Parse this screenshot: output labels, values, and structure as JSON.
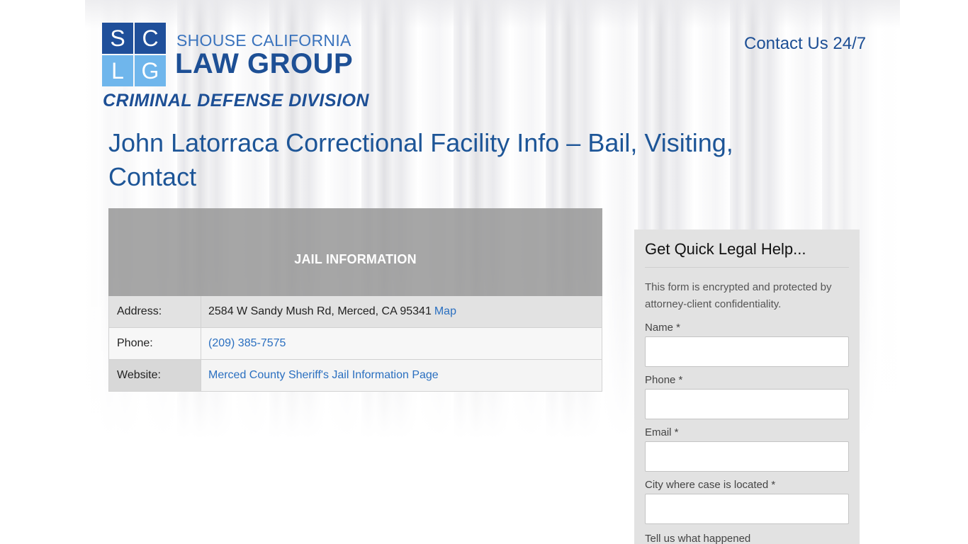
{
  "logo": {
    "letters": [
      "S",
      "C",
      "L",
      "G"
    ],
    "top_text": "SHOUSE CALIFORNIA",
    "main_text": "LAW GROUP",
    "division": "CRIMINAL DEFENSE DIVISION"
  },
  "header": {
    "contact_label": "Contact Us 24/7"
  },
  "page": {
    "title": "John Latorraca Correctional Facility Info – Bail, Visiting, Contact"
  },
  "jail_info": {
    "heading": "JAIL INFORMATION",
    "rows": [
      {
        "label": "Address:",
        "value": "2584 W Sandy Mush Rd, Merced, CA 95341",
        "link": "Map"
      },
      {
        "label": "Phone:",
        "link": "(209) 385-7575"
      },
      {
        "label": "Website:",
        "link": "Merced County Sheriff's Jail Information Page"
      }
    ]
  },
  "form": {
    "title": "Get Quick Legal Help...",
    "note": "This form is encrypted and protected by attorney-client confidentiality.",
    "fields": [
      {
        "label": "Name *",
        "value": ""
      },
      {
        "label": "Phone *",
        "value": ""
      },
      {
        "label": "Email *",
        "value": ""
      },
      {
        "label": "City where case is located *",
        "value": ""
      }
    ],
    "tell_label": "Tell us what happened"
  },
  "colors": {
    "brand_dark": "#1d4f95",
    "brand_light": "#6fb6ec",
    "link": "#2a6fc0"
  }
}
